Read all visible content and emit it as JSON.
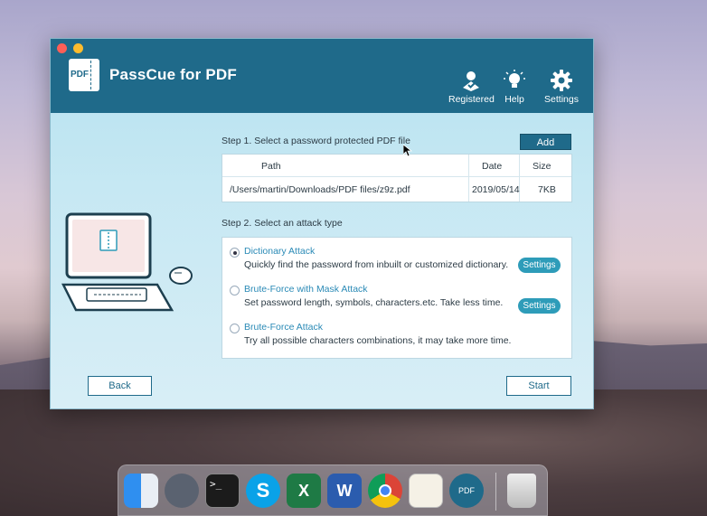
{
  "app": {
    "title": "PassCue for PDF",
    "logo_text": "PDF",
    "toolbar": {
      "registered": "Registered",
      "help": "Help",
      "settings": "Settings"
    }
  },
  "step1": {
    "label": "Step 1. Select a password protected PDF file",
    "add_label": "Add",
    "columns": {
      "path": "Path",
      "date": "Date",
      "size": "Size"
    },
    "files": [
      {
        "path": "/Users/martin/Downloads/PDF files/z9z.pdf",
        "date": "2019/05/14",
        "size": "7KB"
      }
    ]
  },
  "step2": {
    "label": "Step 2. Select an attack type",
    "options": [
      {
        "title": "Dictionary Attack",
        "desc": "Quickly find the password from inbuilt or customized dictionary.",
        "selected": true,
        "settings_label": "Settings"
      },
      {
        "title": "Brute-Force with Mask Attack",
        "desc": "Set password length, symbols, characters.etc. Take less time.",
        "selected": false,
        "settings_label": "Settings"
      },
      {
        "title": "Brute-Force Attack",
        "desc": "Try all possible characters combinations, it may take more time.",
        "selected": false
      }
    ]
  },
  "footer": {
    "back_label": "Back",
    "start_label": "Start"
  },
  "dock": {
    "items": [
      "finder-icon",
      "launchpad-icon",
      "terminal-icon",
      "skype-icon",
      "excel-icon",
      "word-icon",
      "chrome-icon",
      "textedit-icon",
      "passcue-icon",
      "trash-icon"
    ],
    "terminal_text": ">_",
    "skype_text": "S",
    "excel_text": "X",
    "word_text": "W",
    "passcue_text": "PDF"
  },
  "colors": {
    "titlebar": "#1f6a8a",
    "accent": "#2e9cb9",
    "link": "#2a8ab6"
  }
}
